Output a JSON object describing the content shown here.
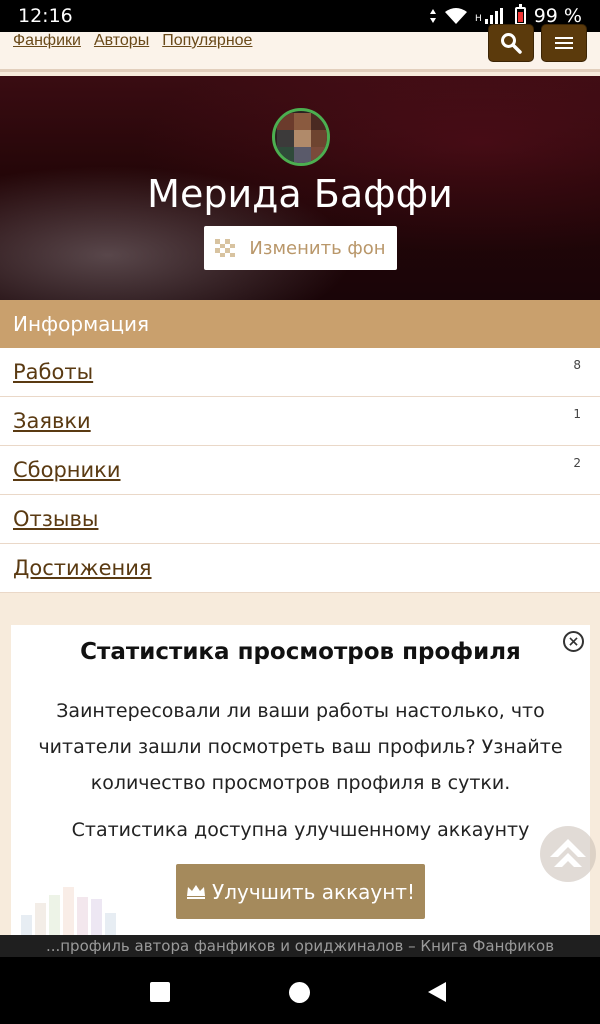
{
  "status_bar": {
    "time": "12:16",
    "network_label": "H",
    "battery": "99 %"
  },
  "top_nav": {
    "links": [
      "Фанфики",
      "Авторы",
      "Популярное"
    ]
  },
  "profile": {
    "name": "Мерида Баффи",
    "change_background_label": "Изменить фон"
  },
  "info": {
    "header": "Информация",
    "items": [
      {
        "label": "Работы",
        "count": "8"
      },
      {
        "label": "Заявки",
        "count": "1"
      },
      {
        "label": "Сборники",
        "count": "2"
      },
      {
        "label": "Отзывы",
        "count": ""
      },
      {
        "label": "Достижения",
        "count": ""
      }
    ]
  },
  "stats_card": {
    "title": "Статистика просмотров профиля",
    "description": "Заинтересовали ли ваши работы настолько, что читатели зашли посмотреть ваш профиль? Узнайте количество просмотров профиля в сутки.",
    "note": "Статистика доступна улучшенному аккаунту",
    "upgrade_label": "Улучшить аккаунт!",
    "close_symbol": "×"
  },
  "caption": "...профиль автора фанфиков и ориджиналов – Книга Фанфиков",
  "colors": {
    "accent": "#c9a06d",
    "button": "#a58a5c",
    "nav_button": "#5b3a0c",
    "link": "#5a3a12"
  },
  "icons": [
    "wifi-icon",
    "signal-icon",
    "battery-icon",
    "search-icon",
    "menu-icon",
    "checkerboard-icon",
    "close-icon",
    "crown-icon",
    "scroll-top-icon",
    "nav-recents-icon",
    "nav-home-icon",
    "nav-back-icon"
  ]
}
